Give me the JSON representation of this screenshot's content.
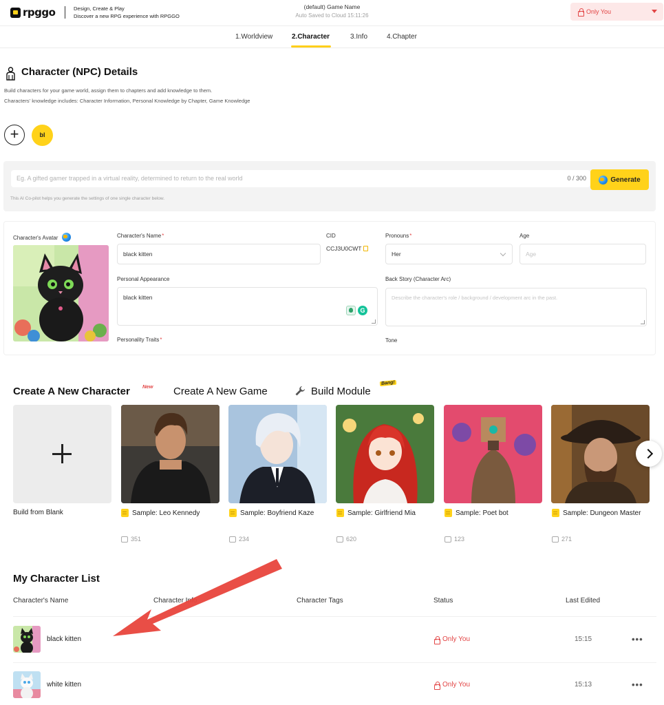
{
  "brand": {
    "logo_text": "rpggo",
    "tagline_line1": "Design, Create & Play",
    "tagline_line2": "Discover a new RPG experience with RPGGO"
  },
  "header": {
    "game_name": "(default) Game Name",
    "autosave": "Auto Saved to Cloud 15:11:26",
    "visibility": "Only You",
    "visibility_color": "#e24545"
  },
  "steps": [
    {
      "label": "1.Worldview",
      "active": false
    },
    {
      "label": "2.Character",
      "active": true
    },
    {
      "label": "3.Info",
      "active": false
    },
    {
      "label": "4.Chapter",
      "active": false
    }
  ],
  "page": {
    "title": "Character (NPC) Details",
    "desc_line1": "Build characters for your game world, assign them to chapters and add knowledge to them.",
    "desc_line2": "Characters' knowledge includes: Character Information, Personal Knowledge by Chapter, Game Knowledge",
    "add_icon": "+",
    "selected_char_initials": "bl"
  },
  "copilot": {
    "placeholder": "Eg. A gifted gamer trapped in a virtual reality, determined to return to the real world",
    "counter": "0 / 300",
    "generate_label": "Generate",
    "hint": "This AI Co-pilot helps you generate the settings of one single character below."
  },
  "form": {
    "avatar_label": "Character's Avatar",
    "name_label": "Character's Name",
    "name_value": "black kitten",
    "cid_label": "CID",
    "cid_value": "CCJ3U0CWT",
    "pronouns_label": "Pronouns",
    "pronouns_value": "Her",
    "age_label": "Age",
    "age_placeholder": "Age",
    "appearance_label": "Personal Appearance",
    "appearance_value": "black kitten",
    "backstory_label": "Back Story (Character Arc)",
    "backstory_placeholder": "Describe the character's role / background / development arc in the past.",
    "traits_label": "Personality Traits",
    "tone_label": "Tone",
    "required_mark": "*"
  },
  "quick_create": {
    "tab_character": "Create A New Character",
    "new_badge": "New",
    "tab_game": "Create A New Game",
    "tab_module": "Build Module",
    "bang_badge": "Bang!",
    "blank_label": "Build from Blank",
    "samples": [
      {
        "label": "Sample: Leo Kennedy",
        "count": "351"
      },
      {
        "label": "Sample: Boyfriend Kaze",
        "count": "234"
      },
      {
        "label": "Sample: Girlfriend Mia",
        "count": "620"
      },
      {
        "label": "Sample: Poet bot",
        "count": "123"
      },
      {
        "label": "Sample: Dungeon Master",
        "count": "271"
      }
    ]
  },
  "list": {
    "title": "My Character List",
    "col_name": "Character's Name",
    "col_info": "Character Info",
    "col_tags": "Character Tags",
    "col_status": "Status",
    "col_edited": "Last Edited",
    "rows": [
      {
        "name": "black kitten",
        "status": "Only You",
        "time": "15:15",
        "more": "•••"
      },
      {
        "name": "white kitten",
        "status": "Only You",
        "time": "15:13",
        "more": "•••"
      }
    ]
  },
  "colors": {
    "accent_yellow": "#ffd21a",
    "status_red": "#e24545",
    "annotation_arrow": "#e8453c"
  }
}
